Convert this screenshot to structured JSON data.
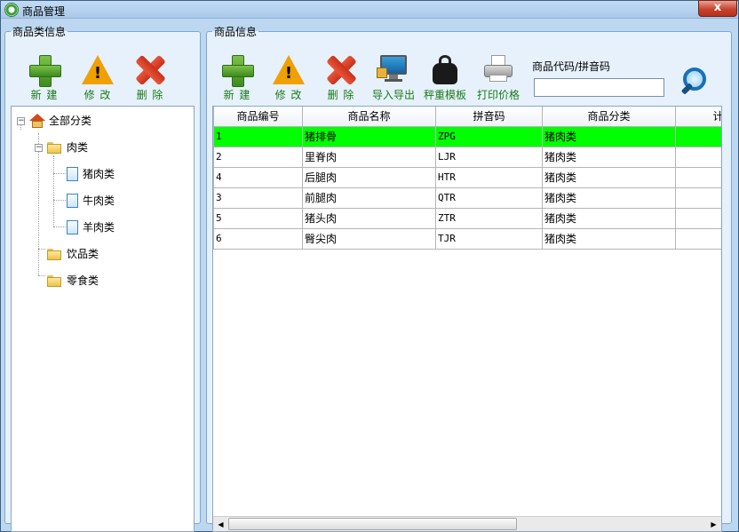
{
  "window": {
    "title": "商品管理",
    "close_label": "x"
  },
  "left_panel": {
    "legend": "商品类信息",
    "toolbar": {
      "new_label": "新 建",
      "edit_label": "修 改",
      "delete_label": "删 除"
    },
    "tree": {
      "root": "全部分类",
      "meat": "肉类",
      "pork": "猪肉类",
      "beef": "牛肉类",
      "mutton": "羊肉类",
      "drinks": "饮品类",
      "snacks": "零食类"
    }
  },
  "right_panel": {
    "legend": "商品信息",
    "toolbar": {
      "new_label": "新 建",
      "edit_label": "修 改",
      "delete_label": "删 除",
      "import_export_label": "导入导出",
      "weight_template_label": "秤重模板",
      "print_price_label": "打印价格"
    },
    "search": {
      "label": "商品代码/拼音码",
      "value": ""
    },
    "table": {
      "headers": [
        "商品编号",
        "商品名称",
        "拼音码",
        "商品分类",
        "计量单"
      ],
      "rows": [
        [
          "1",
          "猪排骨",
          "ZPG",
          "猪肉类",
          ""
        ],
        [
          "2",
          "里脊肉",
          "LJR",
          "猪肉类",
          ""
        ],
        [
          "4",
          "后腿肉",
          "HTR",
          "猪肉类",
          ""
        ],
        [
          "3",
          "前腿肉",
          "QTR",
          "猪肉类",
          ""
        ],
        [
          "5",
          "猪头肉",
          "ZTR",
          "猪肉类",
          ""
        ],
        [
          "6",
          "臀尖肉",
          "TJR",
          "猪肉类",
          ""
        ]
      ]
    }
  },
  "colors": {
    "selected_row": "#00ff00",
    "toolbar_label": "#1a7a1a"
  }
}
